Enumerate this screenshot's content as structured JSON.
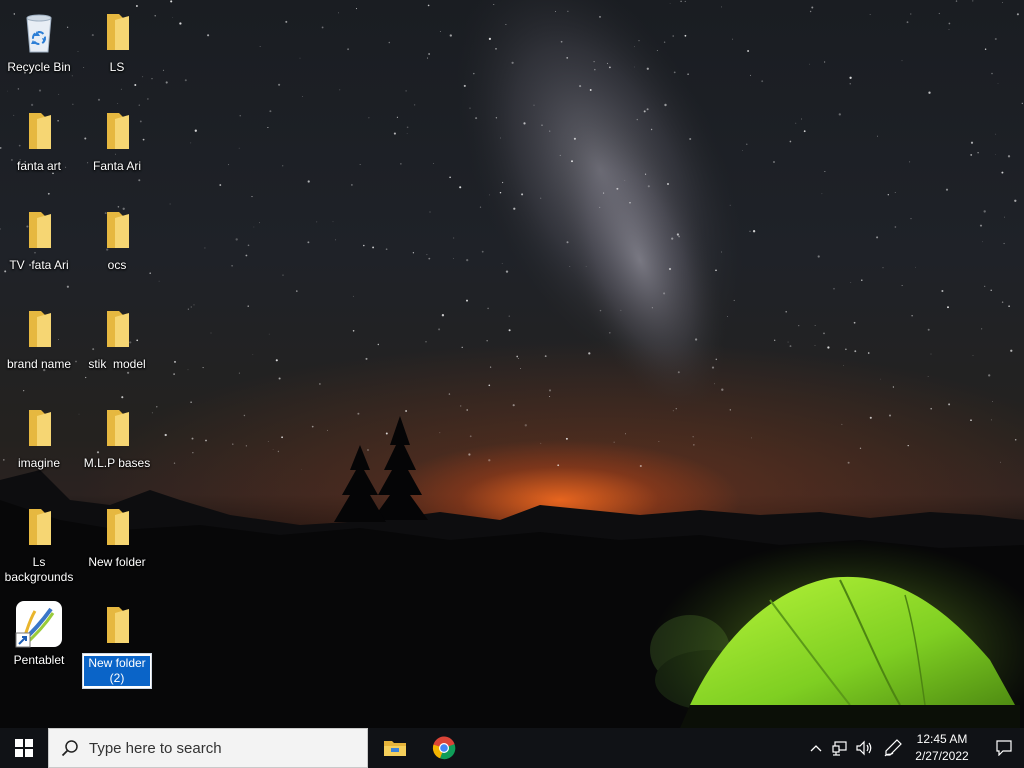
{
  "desktop": {
    "icons": [
      {
        "label": "Recycle Bin",
        "icon": "recycle-bin-icon"
      },
      {
        "label": "LS",
        "icon": "folder-icon"
      },
      {
        "label": "fanta art",
        "icon": "folder-icon"
      },
      {
        "label": "Fanta Ari",
        "icon": "folder-icon"
      },
      {
        "label": "TV  fata Ari",
        "icon": "folder-icon"
      },
      {
        "label": "ocs",
        "icon": "folder-icon"
      },
      {
        "label": "brand name",
        "icon": "folder-icon"
      },
      {
        "label": "stik  model",
        "icon": "folder-icon"
      },
      {
        "label": "imagine",
        "icon": "folder-icon"
      },
      {
        "label": "M.L.P bases",
        "icon": "folder-icon"
      },
      {
        "label": "Ls backgrounds",
        "icon": "folder-icon"
      },
      {
        "label": "New folder",
        "icon": "folder-icon"
      },
      {
        "label": "Pentablet",
        "icon": "pentablet-shortcut-icon"
      },
      {
        "label": "New folder (2)",
        "icon": "folder-icon",
        "selected": true
      }
    ]
  },
  "taskbar": {
    "search_placeholder": "Type here to search",
    "pinned": [
      {
        "name": "File Explorer",
        "icon": "file-explorer-icon"
      },
      {
        "name": "Google Chrome",
        "icon": "chrome-icon"
      }
    ],
    "tray_icons": [
      "chevron-up-icon",
      "network-icon",
      "volume-icon",
      "pen-icon"
    ],
    "time": "12:45 AM",
    "date": "2/27/2022",
    "notification_icon": "action-center-icon"
  },
  "colors": {
    "folder": "#f4cf63",
    "taskbar": "#101216",
    "selection": "#0a64c8",
    "tent": "#8ee12a"
  }
}
